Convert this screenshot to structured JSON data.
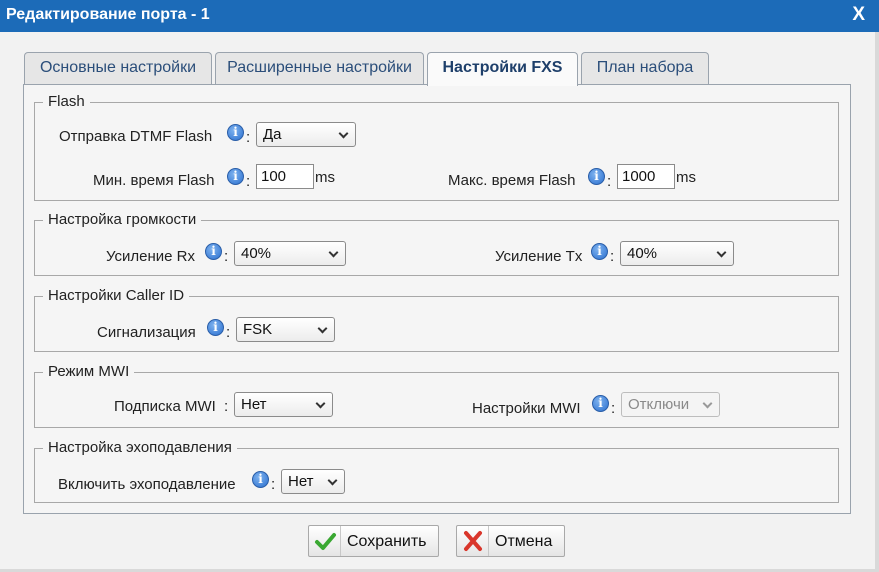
{
  "window": {
    "title": "Редактирование порта - 1",
    "close_label": "X"
  },
  "tabs": [
    {
      "label": "Основные настройки",
      "active": false
    },
    {
      "label": "Расширенные настройки",
      "active": false
    },
    {
      "label": "Настройки FXS",
      "active": true
    },
    {
      "label": "План набора",
      "active": false
    }
  ],
  "flash": {
    "legend": "Flash",
    "dtmf_label": "Отправка DTMF Flash",
    "dtmf_value": "Да",
    "min_label": "Мин. время Flash",
    "min_value": "100",
    "min_unit": "ms",
    "max_label": "Макс. время Flash",
    "max_value": "1000",
    "max_unit": "ms"
  },
  "volume": {
    "legend": "Настройка громкости",
    "rx_label": "Усиление Rx",
    "rx_value": "40%",
    "tx_label": "Усиление Tx",
    "tx_value": "40%"
  },
  "callerid": {
    "legend": "Настройки Caller ID",
    "signal_label": "Сигнализация",
    "signal_value": "FSK"
  },
  "mwi": {
    "legend": "Режим MWI",
    "sub_label": "Подписка MWI",
    "sub_value": "Нет",
    "settings_label": "Настройки MWI",
    "settings_value": "Отключи"
  },
  "echo": {
    "legend": "Настройка эхоподавления",
    "enable_label": "Включить эхоподавление",
    "enable_value": "Нет"
  },
  "buttons": {
    "save_label": "Сохранить",
    "cancel_label": "Отмена"
  },
  "info_glyph": "i",
  "colon": ":",
  "colors": {
    "titlebar": "#1c6bb8",
    "tab_text": "#2b4e7a",
    "info_icon": "#2a6fcf",
    "check": "#3aa832",
    "cross": "#d9362b"
  }
}
